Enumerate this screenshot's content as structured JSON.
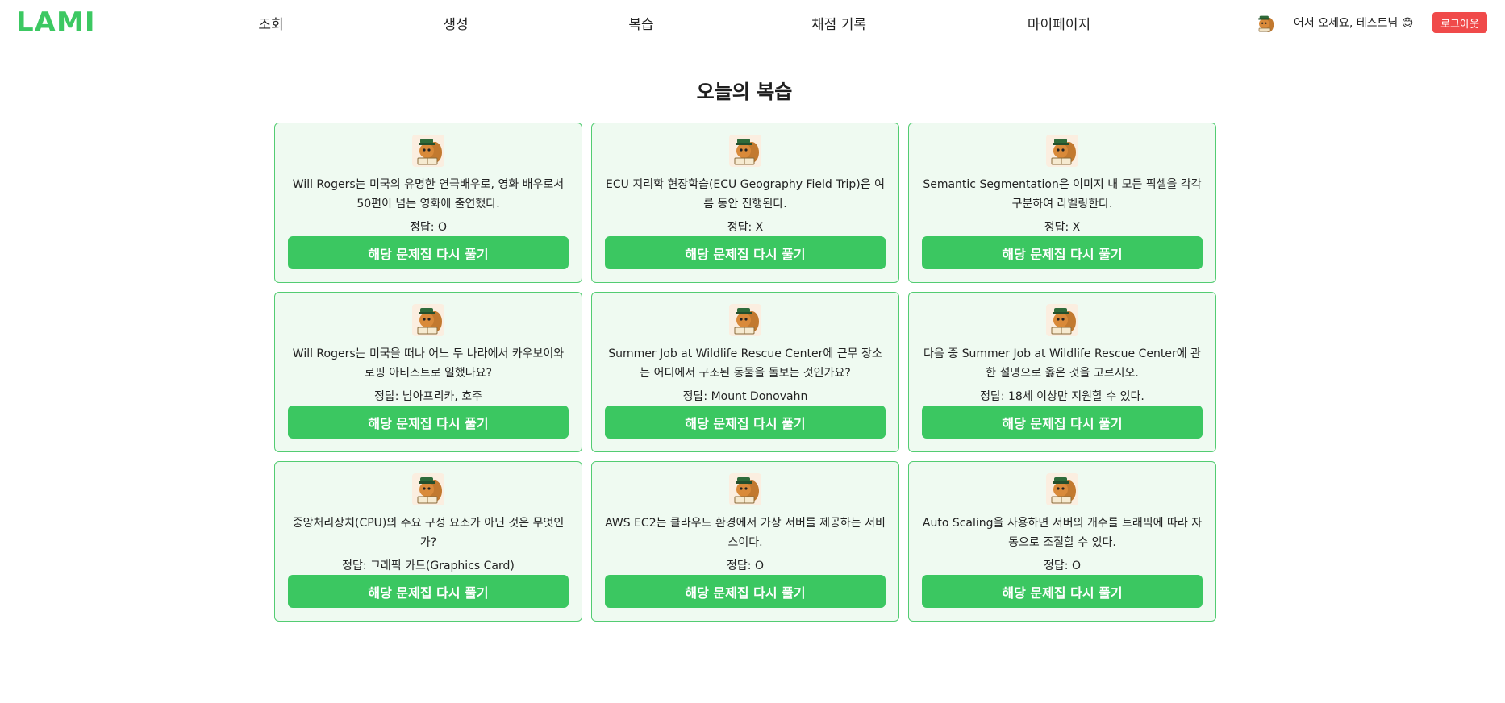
{
  "header": {
    "logo_text": "LAMI",
    "nav": [
      "조회",
      "생성",
      "복습",
      "채점 기록",
      "마이페이지"
    ],
    "welcome": "어서 오세요, 테스트님 😊",
    "logout_label": "로그아웃",
    "avatar_icon": "squirrel-mascot-icon"
  },
  "colors": {
    "brand": "#3cc862",
    "button": "#3bc761",
    "card_bg": "#effaf1",
    "card_border": "#53cc72",
    "logout": "#f04a4a"
  },
  "main": {
    "title": "오늘의 복습",
    "cards": [
      {
        "question": "Will Rogers는 미국의 유명한 연극배우로, 영화 배우로서 50편이 넘는 영화에 출연했다.",
        "answer": "정답: O",
        "button": "해당 문제집 다시 풀기"
      },
      {
        "question": "ECU 지리학 현장학습(ECU Geography Field Trip)은 여름 동안 진행된다.",
        "answer": "정답: X",
        "button": "해당 문제집 다시 풀기"
      },
      {
        "question": "Semantic Segmentation은 이미지 내 모든 픽셀을 각각 구분하여 라벨링한다.",
        "answer": "정답: X",
        "button": "해당 문제집 다시 풀기"
      },
      {
        "question": "Will Rogers는 미국을 떠나 어느 두 나라에서 카우보이와 로핑 아티스트로 일했나요?",
        "answer": "정답: 남아프리카, 호주",
        "button": "해당 문제집 다시 풀기"
      },
      {
        "question": "Summer Job at Wildlife Rescue Center에 근무 장소는 어디에서 구조된 동물을 돌보는 것인가요?",
        "answer": "정답: Mount Donovahn",
        "button": "해당 문제집 다시 풀기"
      },
      {
        "question": "다음 중 Summer Job at Wildlife Rescue Center에 관한 설명으로 옳은 것을 고르시오.",
        "answer": "정답: 18세 이상만 지원할 수 있다.",
        "button": "해당 문제집 다시 풀기"
      },
      {
        "question": "중앙처리장치(CPU)의 주요 구성 요소가 아닌 것은 무엇인가?",
        "answer": "정답: 그래픽 카드(Graphics Card)",
        "button": "해당 문제집 다시 풀기"
      },
      {
        "question": "AWS EC2는 클라우드 환경에서 가상 서버를 제공하는 서비스이다.",
        "answer": "정답: O",
        "button": "해당 문제집 다시 풀기"
      },
      {
        "question": "Auto Scaling을 사용하면 서버의 개수를 트래픽에 따라 자동으로 조절할 수 있다.",
        "answer": "정답: O",
        "button": "해당 문제집 다시 풀기"
      }
    ]
  }
}
